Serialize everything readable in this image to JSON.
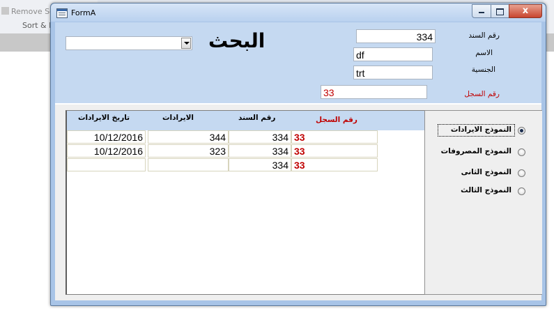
{
  "background": {
    "remove_label": "Remove So",
    "sort_label": "Sort & F"
  },
  "window": {
    "title": "FormA",
    "close_glyph": "x"
  },
  "search": {
    "title": "البحث",
    "combo_value": ""
  },
  "fields": {
    "doc_no_label": "رقم السند",
    "doc_no_value": "334",
    "name_label": "الاسم",
    "name_value": "df",
    "nationality_label": "الجنسية",
    "nationality_value": "trt",
    "record_no_label": "رقم السجل",
    "record_no_value": "33"
  },
  "table": {
    "headers": {
      "record_no": "رقم السجل",
      "doc_no": "رقم السند",
      "revenue": "الايرادات",
      "revenue_date": "تاريخ الايرادات"
    },
    "rows": [
      {
        "record_no": "33",
        "doc_no": "334",
        "revenue": "344",
        "revenue_date": "10/12/2016"
      },
      {
        "record_no": "33",
        "doc_no": "334",
        "revenue": "323",
        "revenue_date": "10/12/2016"
      },
      {
        "record_no": "33",
        "doc_no": "334",
        "revenue": "",
        "revenue_date": ""
      }
    ]
  },
  "options": [
    {
      "label": "النموذج الايرادات",
      "selected": true
    },
    {
      "label": "النموذج المصروفات",
      "selected": false
    },
    {
      "label": "النموذج الثانى",
      "selected": false
    },
    {
      "label": "النموذج الثالث",
      "selected": false
    }
  ],
  "colors": {
    "header_bg": "#c5d9f1",
    "record_accent": "#c00000"
  }
}
